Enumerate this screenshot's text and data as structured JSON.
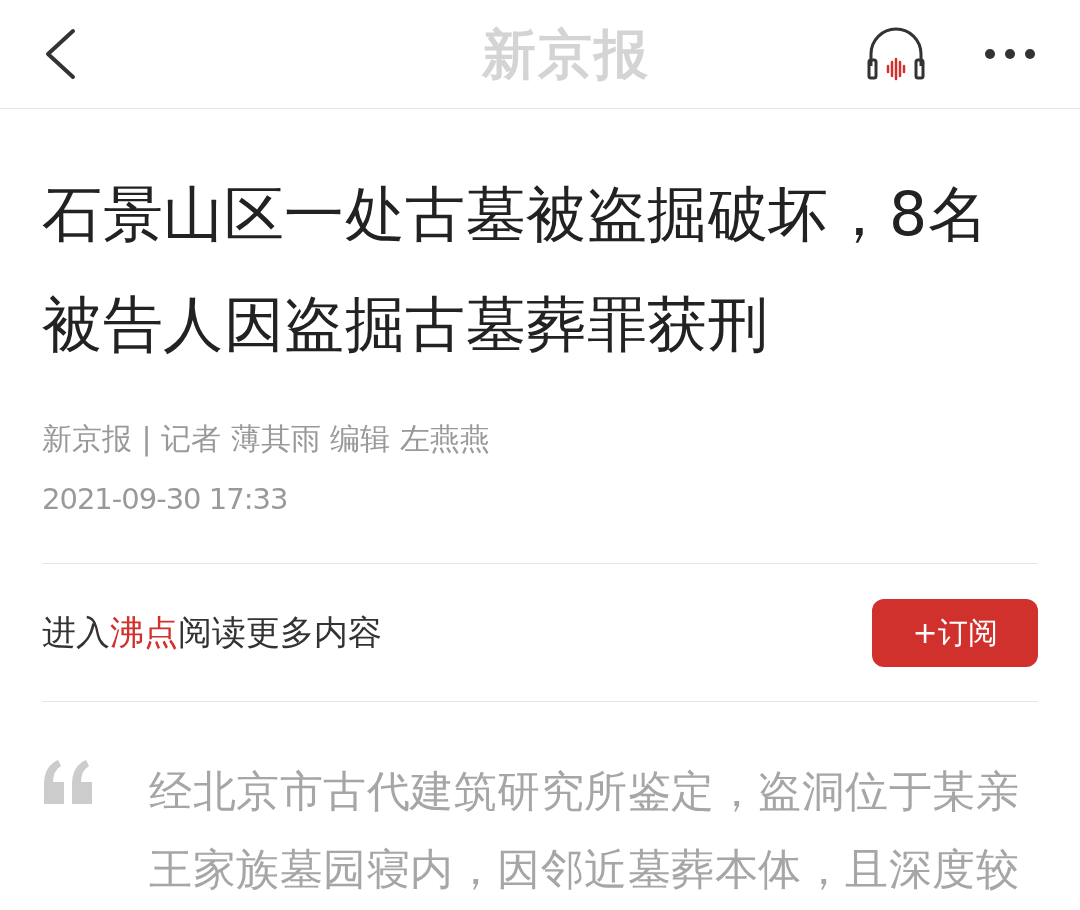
{
  "header": {
    "title": "新京报"
  },
  "article": {
    "title": "石景山区一处古墓被盗掘破坏，8名被告人因盗掘古墓葬罪获刑",
    "byline": "新京报 | 记者 薄其雨 编辑 左燕燕",
    "date": "2021-09-30 17:33"
  },
  "promo": {
    "prefix": "进入",
    "link": "沸点",
    "suffix": "阅读更多内容",
    "button": "+订阅"
  },
  "quote": {
    "text": "经北京市古代建筑研究所鉴定，盗洞位于某亲王家族墓园寝内，因邻近墓葬本体，且深度较"
  }
}
